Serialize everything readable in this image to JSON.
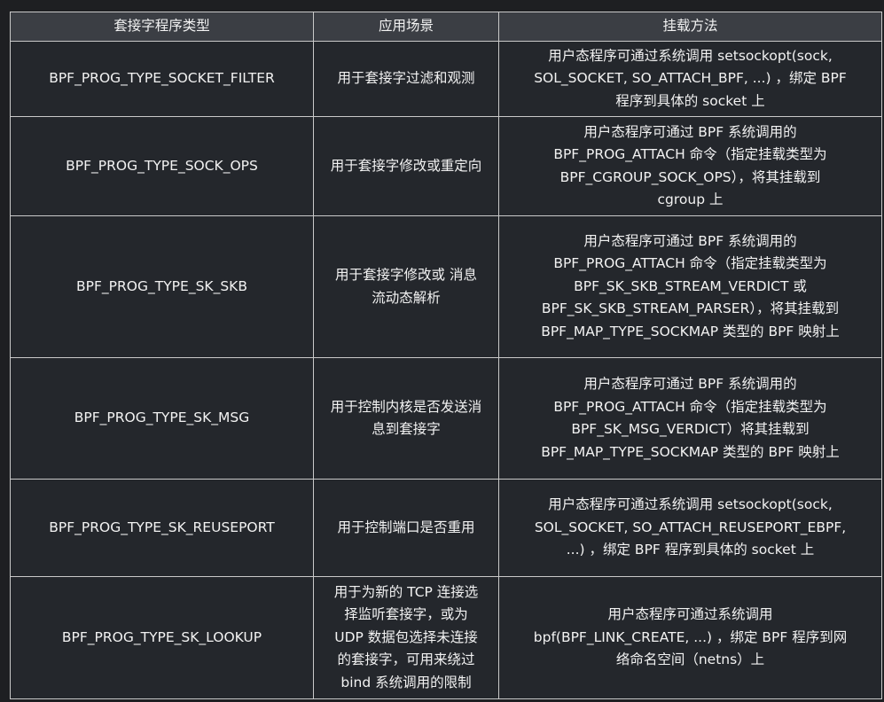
{
  "table": {
    "headers": [
      "套接字程序类型",
      "应用场景",
      "挂载方法"
    ],
    "rows": [
      {
        "type": "BPF_PROG_TYPE_SOCKET_FILTER",
        "scenario": [
          "用于套接字过滤和观测"
        ],
        "method": [
          "用户态程序可通过系统调用 setsockopt(sock,",
          "SOL_SOCKET, SO_ATTACH_BPF, ...) ，绑定 BPF",
          "程序到具体的 socket 上"
        ]
      },
      {
        "type": "BPF_PROG_TYPE_SOCK_OPS",
        "scenario": [
          "用于套接字修改或重定向"
        ],
        "method": [
          "用户态程序可通过 BPF 系统调用的",
          "BPF_PROG_ATTACH 命令（指定挂载类型为",
          "BPF_CGROUP_SOCK_OPS），将其挂载到",
          "cgroup 上"
        ]
      },
      {
        "type": "BPF_PROG_TYPE_SK_SKB",
        "scenario": [
          "用于套接字修改或 消息",
          "流动态解析"
        ],
        "method": [
          "用户态程序可通过 BPF 系统调用的",
          "BPF_PROG_ATTACH 命令（指定挂载类型为",
          "BPF_SK_SKB_STREAM_VERDICT 或",
          "BPF_SK_SKB_STREAM_PARSER），将其挂载到",
          "BPF_MAP_TYPE_SOCKMAP 类型的 BPF 映射上"
        ]
      },
      {
        "type": "BPF_PROG_TYPE_SK_MSG",
        "scenario": [
          "用于控制内核是否发送消",
          "息到套接字"
        ],
        "method": [
          "用户态程序可通过 BPF 系统调用的",
          "BPF_PROG_ATTACH 命令（指定挂载类型为",
          "BPF_SK_MSG_VERDICT）将其挂载到",
          "BPF_MAP_TYPE_SOCKMAP 类型的 BPF 映射上"
        ]
      },
      {
        "type": "BPF_PROG_TYPE_SK_REUSEPORT",
        "scenario": [
          "用于控制端口是否重用"
        ],
        "method": [
          "用户态程序可通过系统调用 setsockopt(sock,",
          "SOL_SOCKET, SO_ATTACH_REUSEPORT_EBPF,",
          "...) ，绑定 BPF 程序到具体的 socket 上"
        ]
      },
      {
        "type": "BPF_PROG_TYPE_SK_LOOKUP",
        "scenario": [
          "用于为新的 TCP 连接选",
          "择监听套接字，或为",
          "UDP 数据包选择未连接",
          "的套接字，可用来绕过",
          "bind 系统调用的限制"
        ],
        "method": [
          "用户态程序可通过系统调用",
          "bpf(BPF_LINK_CREATE, ...) ，绑定 BPF 程序到网",
          "络命名空间（netns）上"
        ]
      }
    ]
  }
}
